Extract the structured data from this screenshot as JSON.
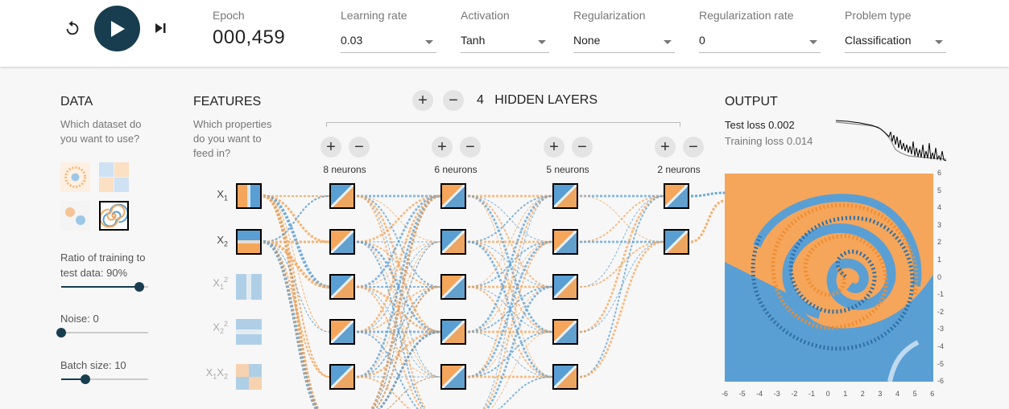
{
  "topbar": {
    "epoch_label": "Epoch",
    "epoch_value": "000,459",
    "dropdowns": [
      {
        "label": "Learning rate",
        "value": "0.03"
      },
      {
        "label": "Activation",
        "value": "Tanh"
      },
      {
        "label": "Regularization",
        "value": "None"
      },
      {
        "label": "Regularization rate",
        "value": "0"
      },
      {
        "label": "Problem type",
        "value": "Classification"
      }
    ]
  },
  "data": {
    "title": "DATA",
    "subtitle_line1": "Which dataset do",
    "subtitle_line2": "you want to use?",
    "ratio_label_line1": "Ratio of training to",
    "ratio_label_line2": "test data:  90%",
    "ratio_value": 0.9,
    "noise_label": "Noise:  0",
    "noise_value": 0,
    "batch_label": "Batch size:  10",
    "batch_value": 0.28
  },
  "features": {
    "title": "FEATURES",
    "subtitle_line1": "Which properties",
    "subtitle_line2": "do you want to",
    "subtitle_line3": "feed in?"
  },
  "network": {
    "layer_count": "4",
    "hidden_layers_label": "HIDDEN LAYERS",
    "plus": "+",
    "minus": "−",
    "neuron_counts": [
      "8 neurons",
      "6 neurons",
      "5 neurons",
      "2 neurons"
    ]
  },
  "output": {
    "title": "OUTPUT",
    "test_loss": "Test loss 0.002",
    "training_loss": "Training loss 0.014",
    "y_ticks": [
      "6",
      "5",
      "4",
      "3",
      "2",
      "1",
      "0",
      "-1",
      "-2",
      "-3",
      "-4",
      "-5",
      "-6"
    ],
    "x_ticks": [
      "-6",
      "-5",
      "-4",
      "-3",
      "-2",
      "-1",
      "0",
      "1",
      "2",
      "3",
      "4",
      "5",
      "6"
    ]
  },
  "colors": {
    "orange": "#f5a65b",
    "blue": "#5a9fd4",
    "dark": "#183d4e"
  }
}
